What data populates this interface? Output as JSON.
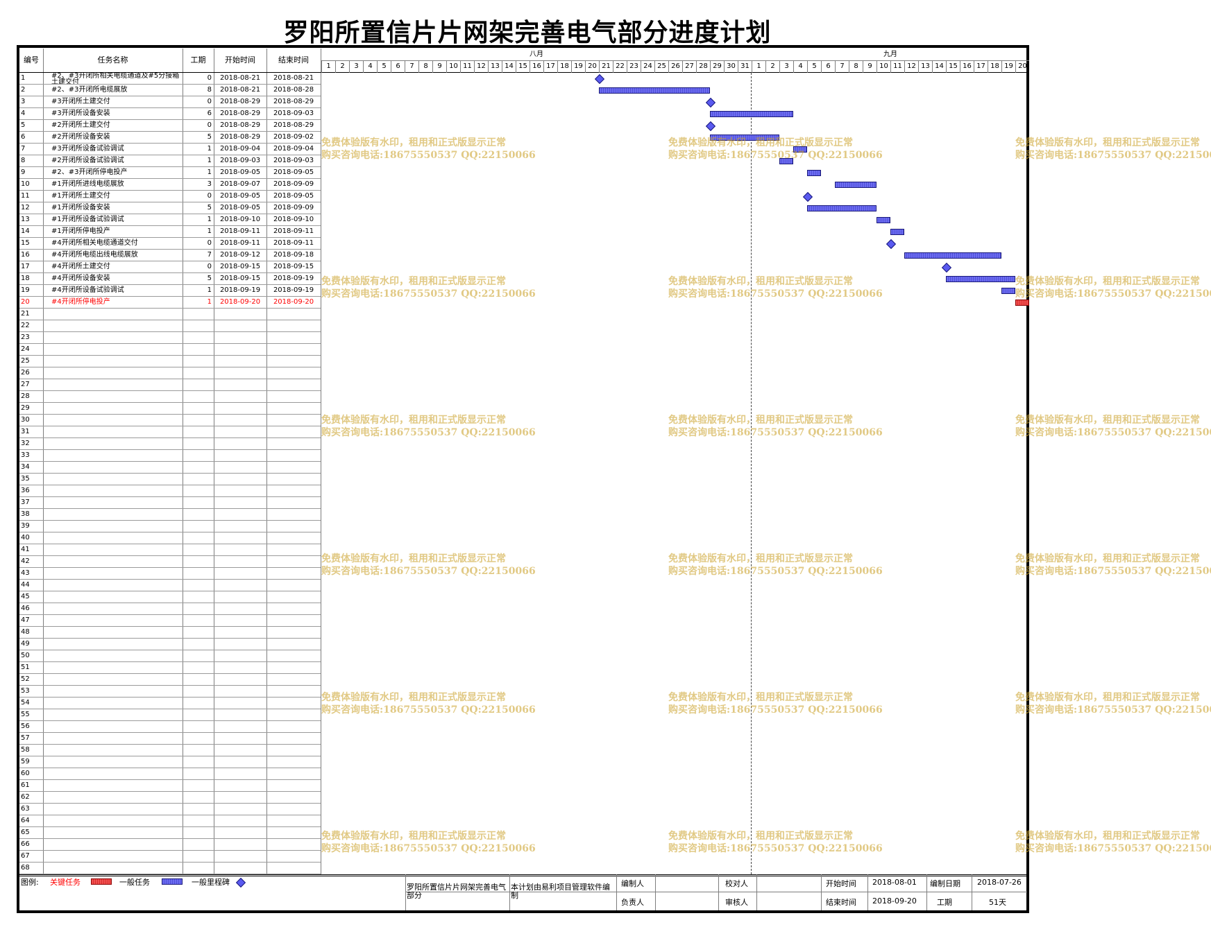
{
  "title": "罗阳所置信片片网架完善电气部分进度计划",
  "headers": {
    "no": "编号",
    "name": "任务名称",
    "duration": "工期",
    "start": "开始时间",
    "end": "结束时间"
  },
  "months": [
    {
      "label": "八月",
      "from_day": 1,
      "to_day": 31
    },
    {
      "label": "九月",
      "from_day": 1,
      "to_day": 20
    }
  ],
  "timeline": {
    "start": "2018-08-01",
    "end": "2018-09-20",
    "today_line": "2018-09-01"
  },
  "tasks": [
    {
      "no": "1",
      "name": "#2、#3开闭所相关电缆通道及#5分接箱土建交付",
      "duration": "0",
      "start": "2018-08-21",
      "end": "2018-08-21",
      "type": "milestone"
    },
    {
      "no": "2",
      "name": "#2、#3开闭所电缆展放",
      "duration": "8",
      "start": "2018-08-21",
      "end": "2018-08-28",
      "type": "task"
    },
    {
      "no": "3",
      "name": "#3开闭所土建交付",
      "duration": "0",
      "start": "2018-08-29",
      "end": "2018-08-29",
      "type": "milestone"
    },
    {
      "no": "4",
      "name": "#3开闭所设备安装",
      "duration": "6",
      "start": "2018-08-29",
      "end": "2018-09-03",
      "type": "task"
    },
    {
      "no": "5",
      "name": "#2开闭所土建交付",
      "duration": "0",
      "start": "2018-08-29",
      "end": "2018-08-29",
      "type": "milestone"
    },
    {
      "no": "6",
      "name": "#2开闭所设备安装",
      "duration": "5",
      "start": "2018-08-29",
      "end": "2018-09-02",
      "type": "task"
    },
    {
      "no": "7",
      "name": "#3开闭所设备试验调试",
      "duration": "1",
      "start": "2018-09-04",
      "end": "2018-09-04",
      "type": "task"
    },
    {
      "no": "8",
      "name": "#2开闭所设备试验调试",
      "duration": "1",
      "start": "2018-09-03",
      "end": "2018-09-03",
      "type": "task"
    },
    {
      "no": "9",
      "name": "#2、#3开闭所停电投产",
      "duration": "1",
      "start": "2018-09-05",
      "end": "2018-09-05",
      "type": "task"
    },
    {
      "no": "10",
      "name": "#1开闭所进线电缆展放",
      "duration": "3",
      "start": "2018-09-07",
      "end": "2018-09-09",
      "type": "task"
    },
    {
      "no": "11",
      "name": "#1开闭所土建交付",
      "duration": "0",
      "start": "2018-09-05",
      "end": "2018-09-05",
      "type": "milestone"
    },
    {
      "no": "12",
      "name": "#1开闭所设备安装",
      "duration": "5",
      "start": "2018-09-05",
      "end": "2018-09-09",
      "type": "task"
    },
    {
      "no": "13",
      "name": "#1开闭所设备试验调试",
      "duration": "1",
      "start": "2018-09-10",
      "end": "2018-09-10",
      "type": "task"
    },
    {
      "no": "14",
      "name": "#1开闭所停电投产",
      "duration": "1",
      "start": "2018-09-11",
      "end": "2018-09-11",
      "type": "task"
    },
    {
      "no": "15",
      "name": "#4开闭所相关电缆通道交付",
      "duration": "0",
      "start": "2018-09-11",
      "end": "2018-09-11",
      "type": "milestone"
    },
    {
      "no": "16",
      "name": "#4开闭所电缆出线电缆展放",
      "duration": "7",
      "start": "2018-09-12",
      "end": "2018-09-18",
      "type": "task"
    },
    {
      "no": "17",
      "name": "#4开闭所土建交付",
      "duration": "0",
      "start": "2018-09-15",
      "end": "2018-09-15",
      "type": "milestone"
    },
    {
      "no": "18",
      "name": "#4开闭所设备安装",
      "duration": "5",
      "start": "2018-09-15",
      "end": "2018-09-19",
      "type": "task"
    },
    {
      "no": "19",
      "name": "#4开闭所设备试验调试",
      "duration": "1",
      "start": "2018-09-19",
      "end": "2018-09-19",
      "type": "task"
    },
    {
      "no": "20",
      "name": "#4开闭所停电投产",
      "duration": "1",
      "start": "2018-09-20",
      "end": "2018-09-20",
      "type": "critical"
    }
  ],
  "empty_rows": {
    "from": 21,
    "to": 68
  },
  "watermark": {
    "line1": "免费体验版有水印，租用和正式版显示正常",
    "line2": "购买咨询电话:18675550537 QQ:22150066"
  },
  "legend": {
    "label": "图例:",
    "critical": "关键任务",
    "normal": "一般任务",
    "milestone": "一般里程碑"
  },
  "footer": {
    "project_name": "罗阳所置信片片网架完善电气部分",
    "note": "本计划由易利项目管理软件编制",
    "editor_label": "编制人",
    "editor": "",
    "checker_label": "校对人",
    "checker": "",
    "owner_label": "负责人",
    "owner": "",
    "reviewer_label": "审核人",
    "reviewer": "",
    "start_label": "开始时间",
    "start": "2018-08-01",
    "end_label": "结束时间",
    "end": "2018-09-20",
    "edit_date_label": "编制日期",
    "edit_date": "2018-07-26",
    "duration_label": "工期",
    "duration": "51天"
  },
  "colors": {
    "normal_bar": "#5a5af0",
    "critical_bar": "#e84040",
    "critical_text": "#ff0000",
    "watermark": "#d4a93a"
  }
}
